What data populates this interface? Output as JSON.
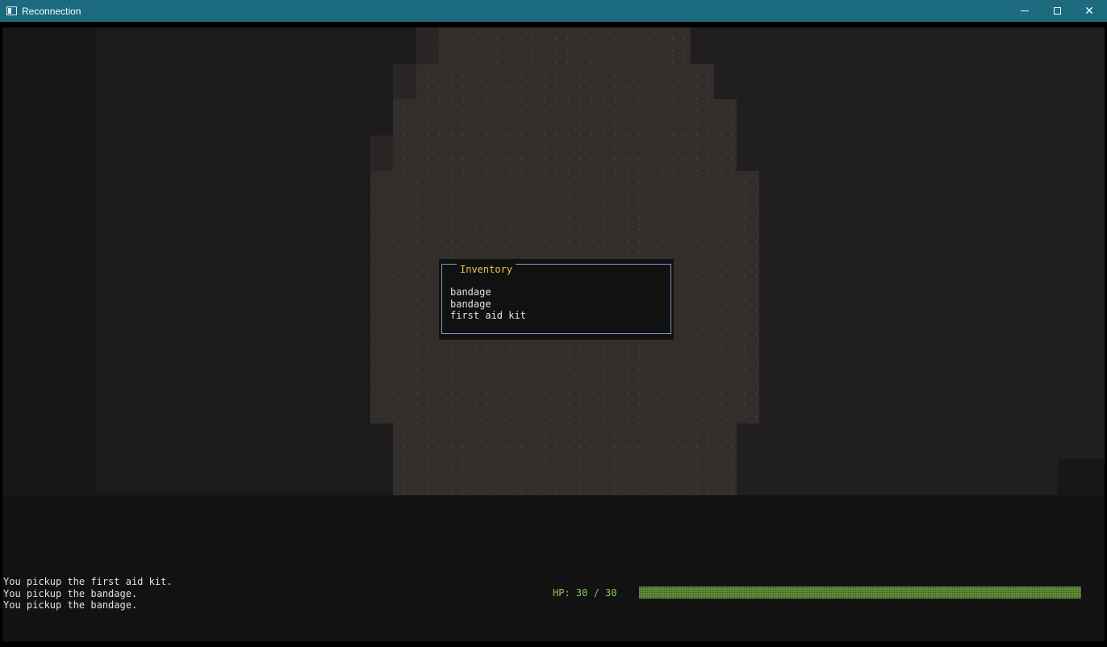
{
  "window": {
    "title": "Reconnection",
    "app_icon": "terminal-window-icon",
    "controls": {
      "minimize": "minimize-icon",
      "maximize": "maximize-icon",
      "close": "close-icon",
      "close_glyph": "✕"
    },
    "titlebar_color": "#1c6a7e"
  },
  "inventory": {
    "title": "Inventory",
    "items": [
      "bandage",
      "bandage",
      "first aid kit"
    ],
    "border_color": "#7c9cc0",
    "title_color": "#f2c14a"
  },
  "message_log": {
    "lines": [
      "You pickup the first aid kit.",
      "You pickup the bandage.",
      "You pickup the bandage."
    ]
  },
  "status": {
    "hp_label": "HP: 30 / 30",
    "hp_current": 30,
    "hp_max": 30,
    "hp_color": "#86c75d"
  }
}
